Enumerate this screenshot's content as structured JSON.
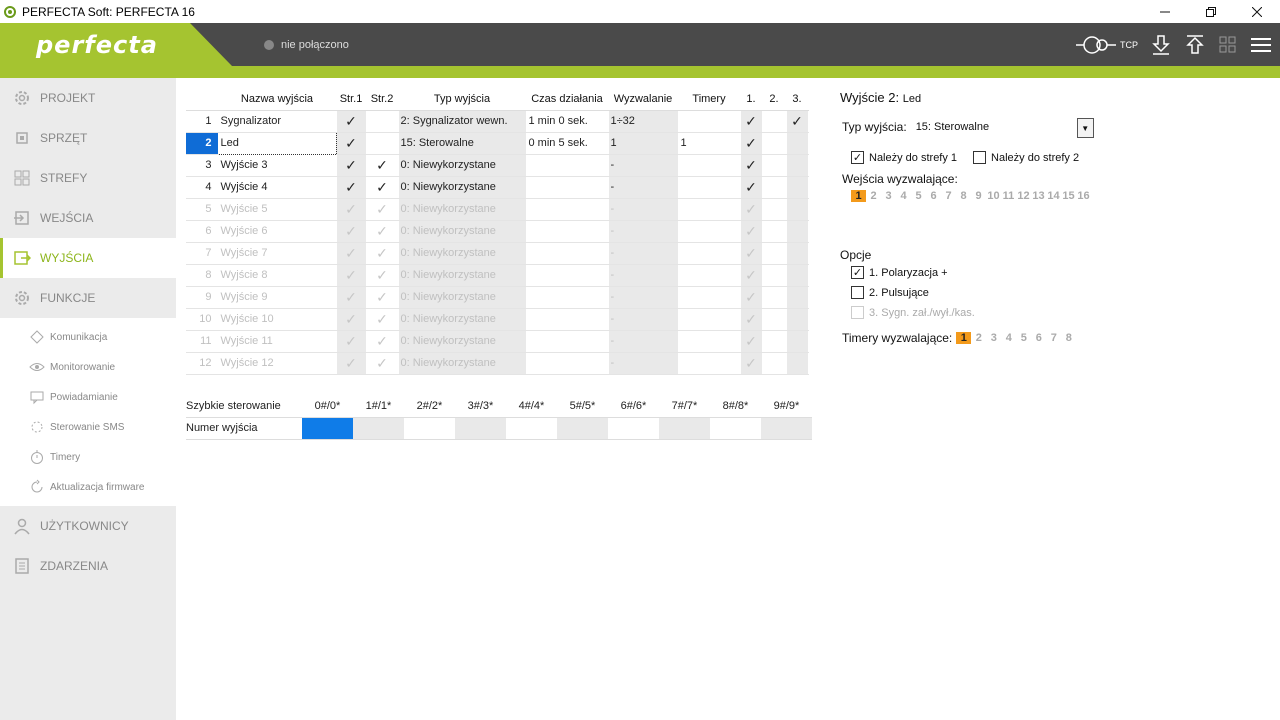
{
  "window": {
    "title": "PERFECTA Soft: PERFECTA 16",
    "min": "—",
    "max": "❐",
    "close": "✕"
  },
  "header": {
    "logo": "perfecta",
    "connection": "nie połączono",
    "tcp": "TCP"
  },
  "sidebar": {
    "items": [
      {
        "label": "PROJEKT",
        "icon": "gear-icon"
      },
      {
        "label": "SPRZĘT",
        "icon": "chip-icon"
      },
      {
        "label": "STREFY",
        "icon": "grid-icon"
      },
      {
        "label": "WEJŚCIA",
        "icon": "input-icon"
      },
      {
        "label": "WYJŚCIA",
        "icon": "output-icon"
      },
      {
        "label": "FUNKCJE",
        "icon": "gear-icon"
      }
    ],
    "subitems": [
      {
        "label": "Komunikacja"
      },
      {
        "label": "Monitorowanie"
      },
      {
        "label": "Powiadamianie"
      },
      {
        "label": "Sterowanie SMS"
      },
      {
        "label": "Timery"
      },
      {
        "label": "Aktualizacja firmware"
      }
    ],
    "bottom": [
      {
        "label": "UŻYTKOWNICY"
      },
      {
        "label": "ZDARZENIA"
      }
    ]
  },
  "table": {
    "headers": [
      "",
      "Nazwa wyjścia",
      "Str.1",
      "Str.2",
      "Typ wyjścia",
      "Czas działania",
      "Wyzwalanie",
      "Timery",
      "1.",
      "2.",
      "3."
    ],
    "rows": [
      {
        "num": "1",
        "name": "Sygnalizator",
        "s1": "✓",
        "s2": "",
        "type": "2: Sygnalizator wewn.",
        "time": "1 min 0 sek.",
        "trig": "1÷32",
        "timers": "",
        "t1": "✓",
        "t2": "",
        "t3": "✓"
      },
      {
        "num": "2",
        "name": "Led",
        "s1": "✓",
        "s2": "",
        "type": "15: Sterowalne",
        "time": "0 min 5 sek.",
        "trig": "1",
        "timers": "1",
        "t1": "✓",
        "t2": "",
        "t3": ""
      },
      {
        "num": "3",
        "name": "Wyjście  3",
        "s1": "✓",
        "s2": "✓",
        "type": "0: Niewykorzystane",
        "time": "",
        "trig": "-",
        "timers": "",
        "t1": "✓",
        "t2": "",
        "t3": ""
      },
      {
        "num": "4",
        "name": "Wyjście  4",
        "s1": "✓",
        "s2": "✓",
        "type": "0: Niewykorzystane",
        "time": "",
        "trig": "-",
        "timers": "",
        "t1": "✓",
        "t2": "",
        "t3": ""
      },
      {
        "num": "5",
        "name": "Wyjście  5",
        "s1": "✓",
        "s2": "✓",
        "type": "0: Niewykorzystane",
        "time": "",
        "trig": "-",
        "timers": "",
        "t1": "✓",
        "t2": "",
        "t3": ""
      },
      {
        "num": "6",
        "name": "Wyjście  6",
        "s1": "✓",
        "s2": "✓",
        "type": "0: Niewykorzystane",
        "time": "",
        "trig": "-",
        "timers": "",
        "t1": "✓",
        "t2": "",
        "t3": ""
      },
      {
        "num": "7",
        "name": "Wyjście  7",
        "s1": "✓",
        "s2": "✓",
        "type": "0: Niewykorzystane",
        "time": "",
        "trig": "-",
        "timers": "",
        "t1": "✓",
        "t2": "",
        "t3": ""
      },
      {
        "num": "8",
        "name": "Wyjście  8",
        "s1": "✓",
        "s2": "✓",
        "type": "0: Niewykorzystane",
        "time": "",
        "trig": "-",
        "timers": "",
        "t1": "✓",
        "t2": "",
        "t3": ""
      },
      {
        "num": "9",
        "name": "Wyjście  9",
        "s1": "✓",
        "s2": "✓",
        "type": "0: Niewykorzystane",
        "time": "",
        "trig": "-",
        "timers": "",
        "t1": "✓",
        "t2": "",
        "t3": ""
      },
      {
        "num": "10",
        "name": "Wyjście 10",
        "s1": "✓",
        "s2": "✓",
        "type": "0: Niewykorzystane",
        "time": "",
        "trig": "-",
        "timers": "",
        "t1": "✓",
        "t2": "",
        "t3": ""
      },
      {
        "num": "11",
        "name": "Wyjście 11",
        "s1": "✓",
        "s2": "✓",
        "type": "0: Niewykorzystane",
        "time": "",
        "trig": "-",
        "timers": "",
        "t1": "✓",
        "t2": "",
        "t3": ""
      },
      {
        "num": "12",
        "name": "Wyjście 12",
        "s1": "✓",
        "s2": "✓",
        "type": "0: Niewykorzystane",
        "time": "",
        "trig": "-",
        "timers": "",
        "t1": "✓",
        "t2": "",
        "t3": ""
      }
    ]
  },
  "quick": {
    "label1": "Szybkie sterowanie",
    "label2": "Numer wyjścia",
    "cols": [
      "0#/0*",
      "1#/1*",
      "2#/2*",
      "3#/3*",
      "4#/4*",
      "5#/5*",
      "6#/6*",
      "7#/7*",
      "8#/8*",
      "9#/9*"
    ]
  },
  "panel": {
    "title": "Wyjście 2:",
    "title_name": "Led",
    "type_label": "Typ wyjścia:",
    "type_value": "15: Sterowalne",
    "zone1": "Należy do strefy 1",
    "zone2": "Należy do strefy 2",
    "inputs_label": "Wejścia wyzwalające:",
    "inputs": [
      "1",
      "2",
      "3",
      "4",
      "5",
      "6",
      "7",
      "8",
      "9",
      "10",
      "11",
      "12",
      "13",
      "14",
      "15",
      "16"
    ],
    "options_label": "Opcje",
    "opt1": "1. Polaryzacja +",
    "opt2": "2. Pulsujące",
    "opt3": "3. Sygn. zał./wył./kas.",
    "timers_label": "Timery wyzwalające:",
    "timers": [
      "1",
      "2",
      "3",
      "4",
      "5",
      "6",
      "7",
      "8"
    ],
    "accent": "#f39a1b"
  }
}
